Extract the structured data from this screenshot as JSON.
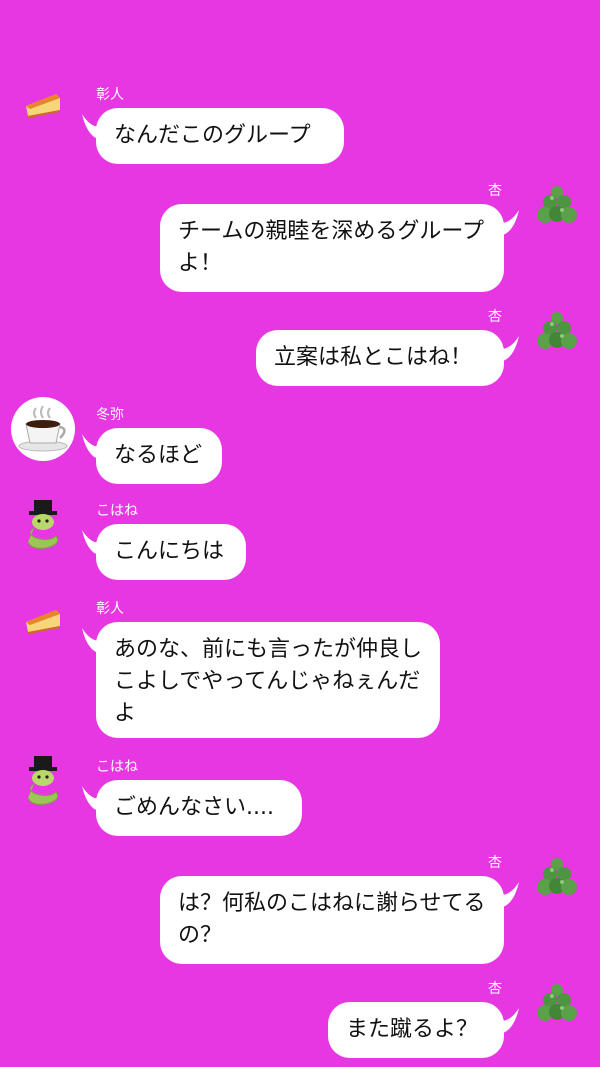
{
  "messages": [
    {
      "side": "left",
      "sender": "彰人",
      "avatar": "cheesecake-icon",
      "text": "なんだこのグループ"
    },
    {
      "side": "right",
      "sender": "杏",
      "avatar": "tree-icon",
      "text": "チームの親睦を深めるグループよ！"
    },
    {
      "side": "right",
      "sender": "杏",
      "avatar": "tree-icon",
      "text": "立案は私とこはね！"
    },
    {
      "side": "left",
      "sender": "冬弥",
      "avatar": "coffee-cup-icon",
      "text": "なるほど"
    },
    {
      "side": "left",
      "sender": "こはね",
      "avatar": "snake-tophat-icon",
      "text": "こんにちは"
    },
    {
      "side": "left",
      "sender": "彰人",
      "avatar": "cheesecake-icon",
      "text": "あのな、前にも言ったが仲良しこよしでやってんじゃねぇんだよ"
    },
    {
      "side": "left",
      "sender": "こはね",
      "avatar": "snake-tophat-icon",
      "text": "ごめんなさい...."
    },
    {
      "side": "right",
      "sender": "杏",
      "avatar": "tree-icon",
      "text": "は？何私のこはねに謝らせてるの？"
    },
    {
      "side": "right",
      "sender": "杏",
      "avatar": "tree-icon",
      "text": "また蹴るよ？"
    }
  ],
  "colors": {
    "background": "#e637e3",
    "bubble": "#ffffff",
    "text": "#111111",
    "name": "#ffffff"
  }
}
